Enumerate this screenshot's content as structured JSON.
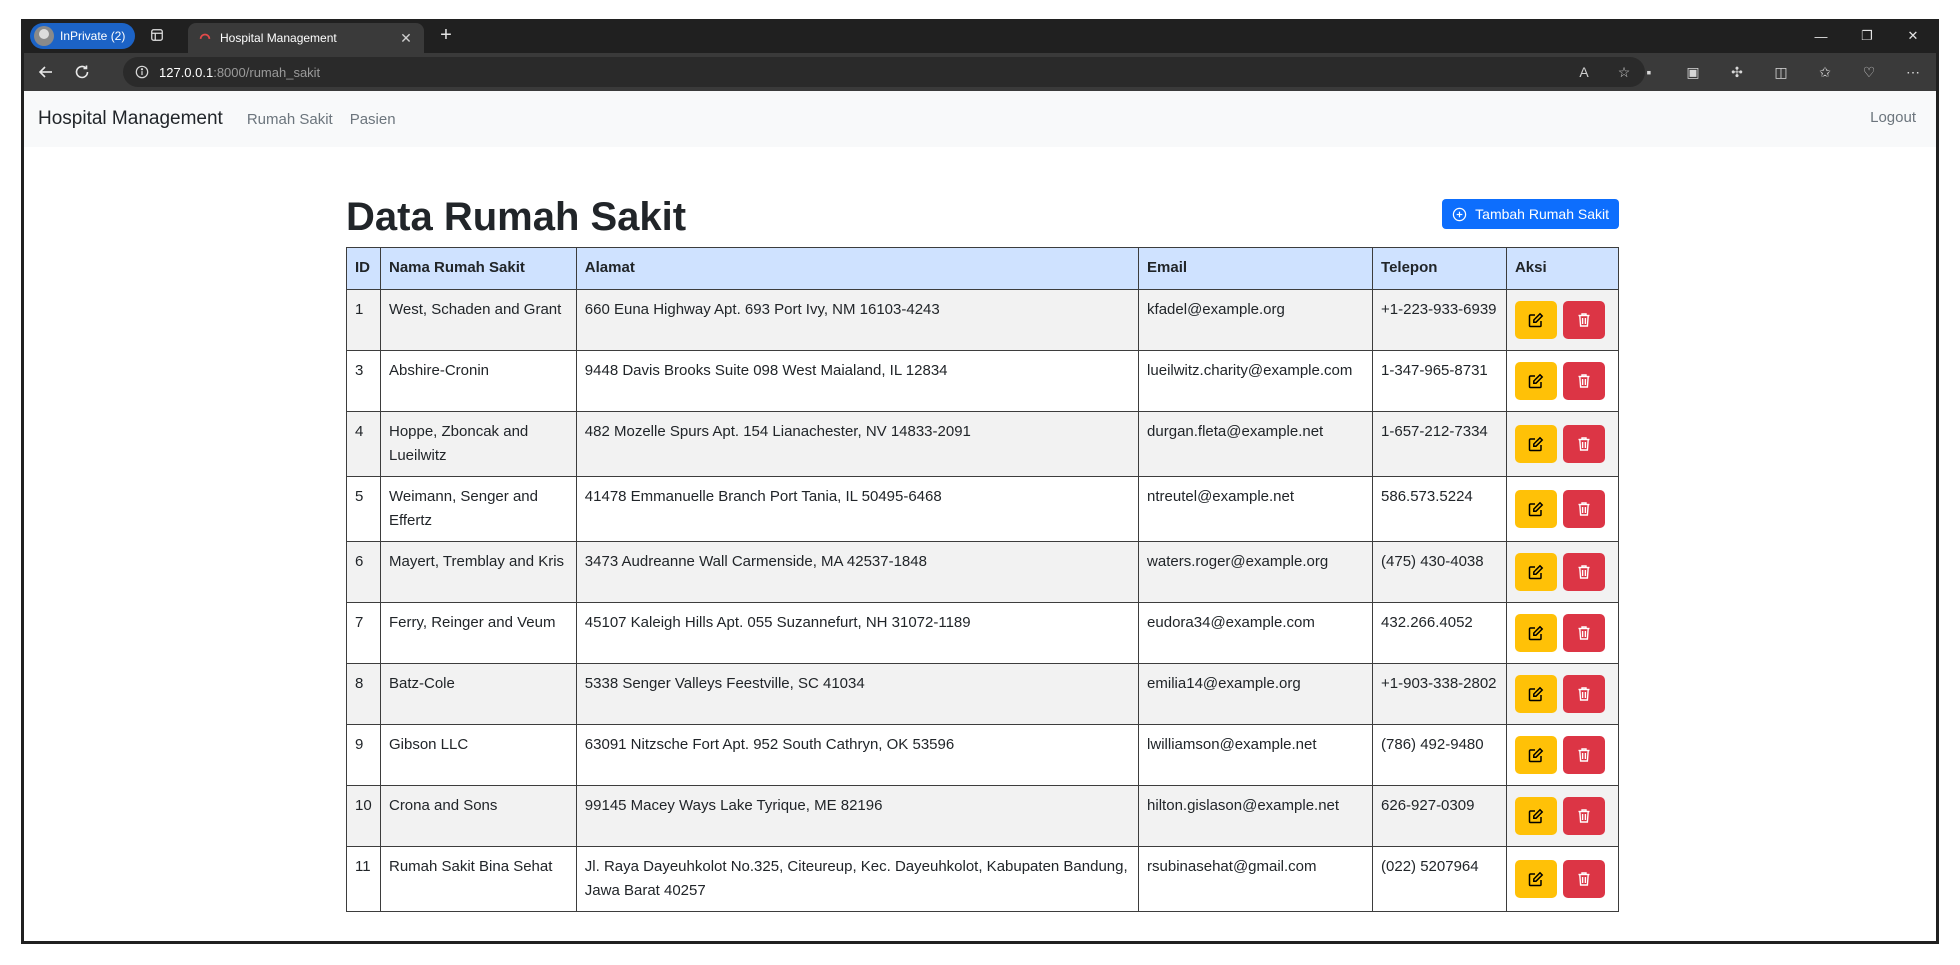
{
  "browser": {
    "profile_label": "InPrivate (2)",
    "tab_title": "Hospital Management",
    "url_host": "127.0.0.1",
    "url_path": ":8000/rumah_sakit"
  },
  "navbar": {
    "brand": "Hospital Management",
    "links": [
      "Rumah Sakit",
      "Pasien"
    ],
    "logout": "Logout"
  },
  "main": {
    "title": "Data Rumah Sakit",
    "add_button": "Tambah Rumah Sakit",
    "columns": [
      "ID",
      "Nama Rumah Sakit",
      "Alamat",
      "Email",
      "Telepon",
      "Aksi"
    ],
    "rows": [
      {
        "id": "1",
        "nama": "West, Schaden and Grant",
        "alamat": "660 Euna Highway Apt. 693 Port Ivy, NM 16103-4243",
        "email": "kfadel@example.org",
        "telepon": "+1-223-933-6939"
      },
      {
        "id": "3",
        "nama": "Abshire-Cronin",
        "alamat": "9448 Davis Brooks Suite 098 West Maialand, IL 12834",
        "email": "lueilwitz.charity@example.com",
        "telepon": "1-347-965-8731"
      },
      {
        "id": "4",
        "nama": "Hoppe, Zboncak and Lueilwitz",
        "alamat": "482 Mozelle Spurs Apt. 154 Lianachester, NV 14833-2091",
        "email": "durgan.fleta@example.net",
        "telepon": "1-657-212-7334"
      },
      {
        "id": "5",
        "nama": "Weimann, Senger and Effertz",
        "alamat": "41478 Emmanuelle Branch Port Tania, IL 50495-6468",
        "email": "ntreutel@example.net",
        "telepon": "586.573.5224"
      },
      {
        "id": "6",
        "nama": "Mayert, Tremblay and Kris",
        "alamat": "3473 Audreanne Wall Carmenside, MA 42537-1848",
        "email": "waters.roger@example.org",
        "telepon": "(475) 430-4038"
      },
      {
        "id": "7",
        "nama": "Ferry, Reinger and Veum",
        "alamat": "45107 Kaleigh Hills Apt. 055 Suzannefurt, NH 31072-1189",
        "email": "eudora34@example.com",
        "telepon": "432.266.4052"
      },
      {
        "id": "8",
        "nama": "Batz-Cole",
        "alamat": "5338 Senger Valleys Feestville, SC 41034",
        "email": "emilia14@example.org",
        "telepon": "+1-903-338-2802"
      },
      {
        "id": "9",
        "nama": "Gibson LLC",
        "alamat": "63091 Nitzsche Fort Apt. 952 South Cathryn, OK 53596",
        "email": "lwilliamson@example.net",
        "telepon": "(786) 492-9480"
      },
      {
        "id": "10",
        "nama": "Crona and Sons",
        "alamat": "99145 Macey Ways Lake Tyrique, ME 82196",
        "email": "hilton.gislason@example.net",
        "telepon": "626-927-0309"
      },
      {
        "id": "11",
        "nama": "Rumah Sakit Bina Sehat",
        "alamat": "Jl. Raya Dayeuhkolot No.325, Citeureup, Kec. Dayeuhkolot, Kabupaten Bandung, Jawa Barat 40257",
        "email": "rsubinasehat@gmail.com",
        "telepon": "(022) 5207964"
      }
    ]
  },
  "colors": {
    "primary": "#0d6efd",
    "warning": "#ffc107",
    "danger": "#dc3545",
    "header_bg": "#cfe2ff"
  }
}
